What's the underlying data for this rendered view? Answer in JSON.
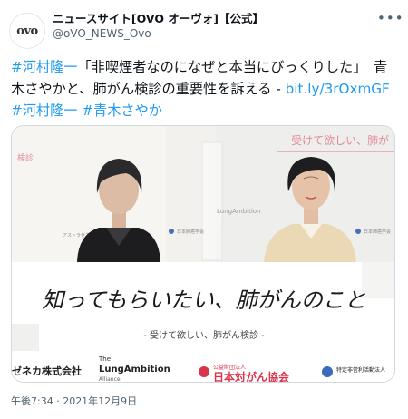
{
  "account": {
    "avatar_logo": "ovo",
    "display_name": "ニュースサイト[OVO オーヴォ]【公式】",
    "handle": "@oVO_NEWS_Ovo"
  },
  "more_icon": "more-icon",
  "tweet": {
    "tag_kawamura": "#河村隆一",
    "quote": "「非喫煙者なのになぜと本当にびっくりした」",
    "body": "青木さやかと、肺がん検診の重要性を訴える - ",
    "link": "bit.ly/3rOxmGF",
    "tag_kawamura2": "#河村隆一",
    "tag_aoki": "#青木さやか"
  },
  "photo": {
    "headline": "知ってもらいたい、肺がんのこと",
    "subtitle": "- 受けて欲しい、肺がん検診 -",
    "top_banner": "- 受けて欲しい、肺が",
    "left_small": "検診",
    "sponsor_left": "ゼネカ株式会社",
    "sponsor_lung_the": "The",
    "sponsor_lung": "LungAmbition",
    "sponsor_lung_alliance": "Alliance",
    "sponsor_mid": "公益財団法人",
    "sponsor_right": "特定非営利活動法人"
  },
  "timestamp": "午後7:34 · 2021年12月9日",
  "colors": {
    "link": "#1d9bf0",
    "muted": "#536471",
    "banner_pink": "#e48a9a"
  }
}
